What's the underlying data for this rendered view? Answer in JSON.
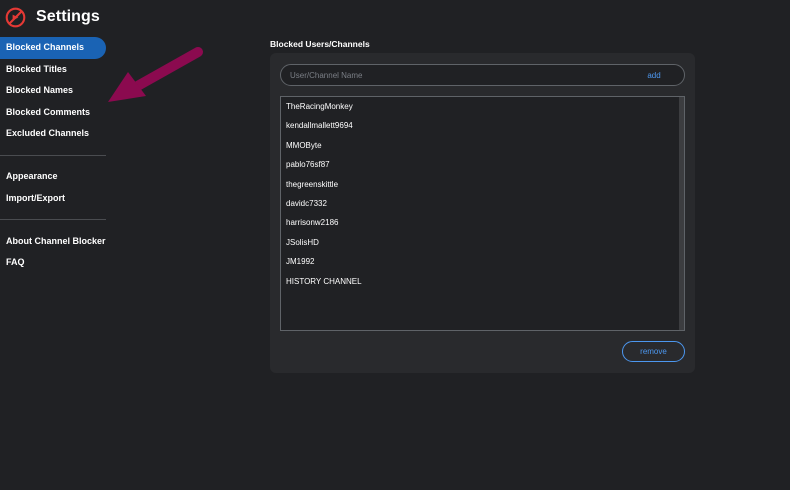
{
  "app": {
    "title": "Settings",
    "logo_icon": "channel-blocker-logo-icon",
    "logo_color": "#e53935"
  },
  "sidebar": {
    "active_color": "#1a63b4",
    "groups": [
      {
        "items": [
          {
            "label": "Blocked Channels",
            "active": true
          },
          {
            "label": "Blocked Titles"
          },
          {
            "label": "Blocked Names"
          },
          {
            "label": "Blocked Comments"
          },
          {
            "label": "Excluded Channels"
          }
        ]
      },
      {
        "items": [
          {
            "label": "Appearance"
          },
          {
            "label": "Import/Export"
          }
        ]
      },
      {
        "items": [
          {
            "label": "About Channel Blocker"
          },
          {
            "label": "FAQ"
          }
        ]
      }
    ]
  },
  "annotation": {
    "icon": "arrow-annotation-icon",
    "color": "#8b0a4f"
  },
  "main": {
    "section_title": "Blocked Users/Channels",
    "input": {
      "placeholder": "User/Channel Name",
      "value": ""
    },
    "add_label": "add",
    "remove_label": "remove",
    "accent_color": "#4c97ef",
    "blocked_list": [
      "TheRacingMonkey",
      "kendallmallett9694",
      "MMOByte",
      "pablo76sf87",
      "thegreenskittle",
      "davidc7332",
      "harrisonw2186",
      "JSolisHD",
      "JM1992",
      "HISTORY CHANNEL"
    ]
  }
}
